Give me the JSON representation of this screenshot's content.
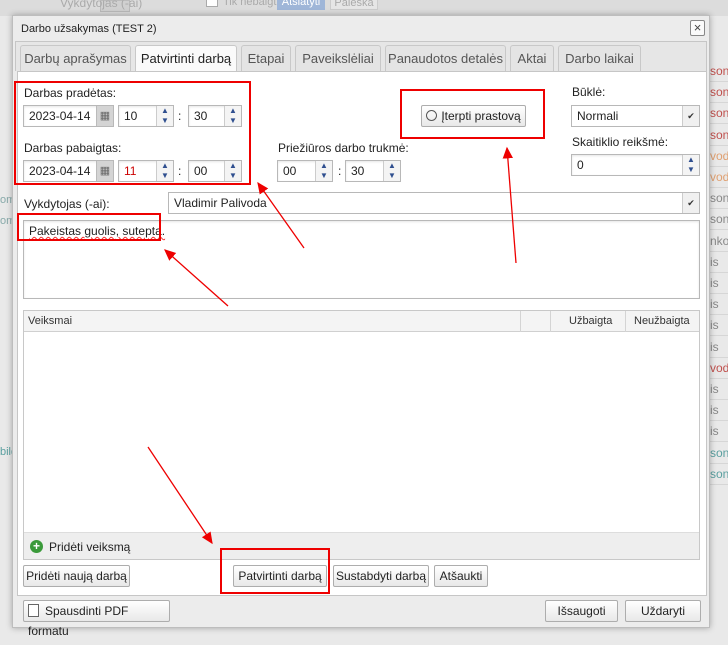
{
  "background": {
    "top_select": "Vykdytojas (-ai)",
    "checkbox_label": "Tik nebaigti",
    "filter_button": "Atšlatyti",
    "search_button": "Paieška",
    "right_rows": [
      {
        "t": "soni",
        "c": "#c0504d"
      },
      {
        "t": "soni",
        "c": "#c0504d"
      },
      {
        "t": "soni",
        "c": "#c0504d"
      },
      {
        "t": "soni",
        "c": "#c0504d"
      },
      {
        "t": "voda",
        "c": "#e0a070"
      },
      {
        "t": "voda",
        "c": "#e0a070"
      },
      {
        "t": "soni",
        "c": "#888"
      },
      {
        "t": "soni",
        "c": "#888"
      },
      {
        "t": "nkov",
        "c": "#888"
      },
      {
        "t": "is",
        "c": "#888"
      },
      {
        "t": "is",
        "c": "#888"
      },
      {
        "t": "is",
        "c": "#888"
      },
      {
        "t": "is",
        "c": "#888"
      },
      {
        "t": "is",
        "c": "#888"
      },
      {
        "t": "voda",
        "c": "#c0504d"
      },
      {
        "t": "is",
        "c": "#888"
      },
      {
        "t": "is",
        "c": "#888"
      },
      {
        "t": "is",
        "c": "#888"
      },
      {
        "t": "soni",
        "c": "#5aa0a0"
      },
      {
        "t": "soni",
        "c": "#5aa0a0"
      }
    ],
    "left_rows": [
      "om",
      "om",
      "bild"
    ]
  },
  "dialog": {
    "title": "Darbo užsakymas (TEST 2)",
    "close": "×"
  },
  "tabs": [
    {
      "label": "Darbų aprašymas"
    },
    {
      "label": "Patvirtinti darbą"
    },
    {
      "label": "Etapai"
    },
    {
      "label": "Paveikslėliai"
    },
    {
      "label": "Panaudotos detalės"
    },
    {
      "label": "Aktai"
    },
    {
      "label": "Darbo laikai"
    }
  ],
  "form": {
    "started_label": "Darbas pradėtas:",
    "started_date": "2023-04-14",
    "started_hour": "10",
    "started_min": "30",
    "ended_label": "Darbas pabaigtas:",
    "ended_date": "2023-04-14",
    "ended_hour": "11",
    "ended_min": "00",
    "sep": ":",
    "duration_label": "Priežiūros darbo trukmė:",
    "duration_hour": "00",
    "duration_min": "30",
    "insert_downtime": "Įterpti prastovą",
    "status_label": "Būklė:",
    "status_value": "Normali",
    "meter_label": "Skaitiklio reikšmė:",
    "meter_value": "0",
    "executor_label": "Vykdytojas (-ai):",
    "executor_value": "Vladimir Palivoda",
    "description": "Pakeistas guolis, sutepta."
  },
  "table": {
    "headers": [
      "Veiksmai",
      "",
      "Užbaigta",
      "Neužbaigta"
    ],
    "add_action": "Pridėti veiksmą"
  },
  "buttons": {
    "new_job": "Pridėti naują darbą",
    "confirm": "Patvirtinti darbą",
    "stop": "Sustabdyti darbą",
    "cancel": "Atšaukti",
    "pdf": "Spausdinti PDF formatu",
    "save": "Išsaugoti",
    "close": "Uždaryti"
  },
  "colors": {
    "annotation": "#ee0000",
    "add_icon": "#3a9a3a"
  }
}
